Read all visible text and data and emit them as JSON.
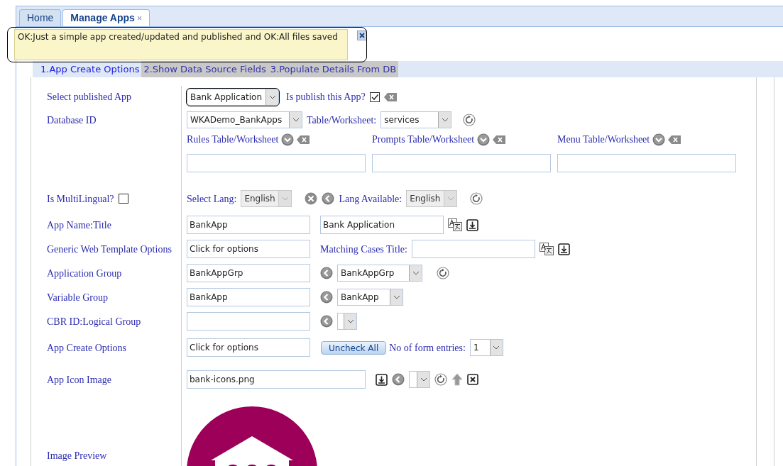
{
  "tabs": [
    {
      "label": "Home",
      "selected": false,
      "closable": false
    },
    {
      "label": "Manage Apps",
      "selected": true,
      "closable": true
    }
  ],
  "tab_close_glyph": "×",
  "notification": {
    "message": "OK:Just a simple app created/updated and published and OK:All files saved"
  },
  "steps": [
    {
      "label": "1.App Create Options",
      "selected": true
    },
    {
      "label": "2.Show Data Source Fields",
      "selected": false
    },
    {
      "label": "3.Populate Details From DB",
      "selected": false
    }
  ],
  "form": {
    "published_app": {
      "label": "Select published App",
      "value": "Bank Application",
      "publish_label": "Is publish this App?",
      "published": true
    },
    "database": {
      "label": "Database ID",
      "value": "WKADemo_BankApps",
      "table_label": "Table/Worksheet:",
      "table_value": "services"
    },
    "worksheets": [
      {
        "label": "Rules Table/Worksheet"
      },
      {
        "label": "Prompts Table/Worksheet"
      },
      {
        "label": "Menu Table/Worksheet"
      }
    ],
    "multilingual": {
      "label": "Is MultiLingual?",
      "checked": false,
      "select_lang_label": "Select Lang:",
      "select_lang": "English",
      "available_label": "Lang Available:",
      "available": "English",
      "disabled": true
    },
    "app_name": {
      "label": "App Name:Title",
      "name": "BankApp",
      "title": "Bank Application"
    },
    "web_template": {
      "label": "Generic Web Template Options",
      "value": "Click for options",
      "matching_label": "Matching Cases Title:"
    },
    "groups": [
      {
        "label": "Application Group",
        "value": "BankAppGrp",
        "select": "BankAppGrp",
        "refresh": true
      },
      {
        "label": "Variable Group",
        "value": "BankApp",
        "select": "BankApp",
        "refresh": false
      },
      {
        "label": "CBR ID:Logical Group",
        "refresh": false
      }
    ],
    "create_options": {
      "label": "App Create Options",
      "value": "Click for options",
      "button": "Uncheck All",
      "entries_label": "No of form entries:",
      "entries": "1"
    },
    "icon_image": {
      "label": "App Icon Image",
      "value": "bank-icons.png",
      "preview_label": "Image Preview"
    }
  }
}
